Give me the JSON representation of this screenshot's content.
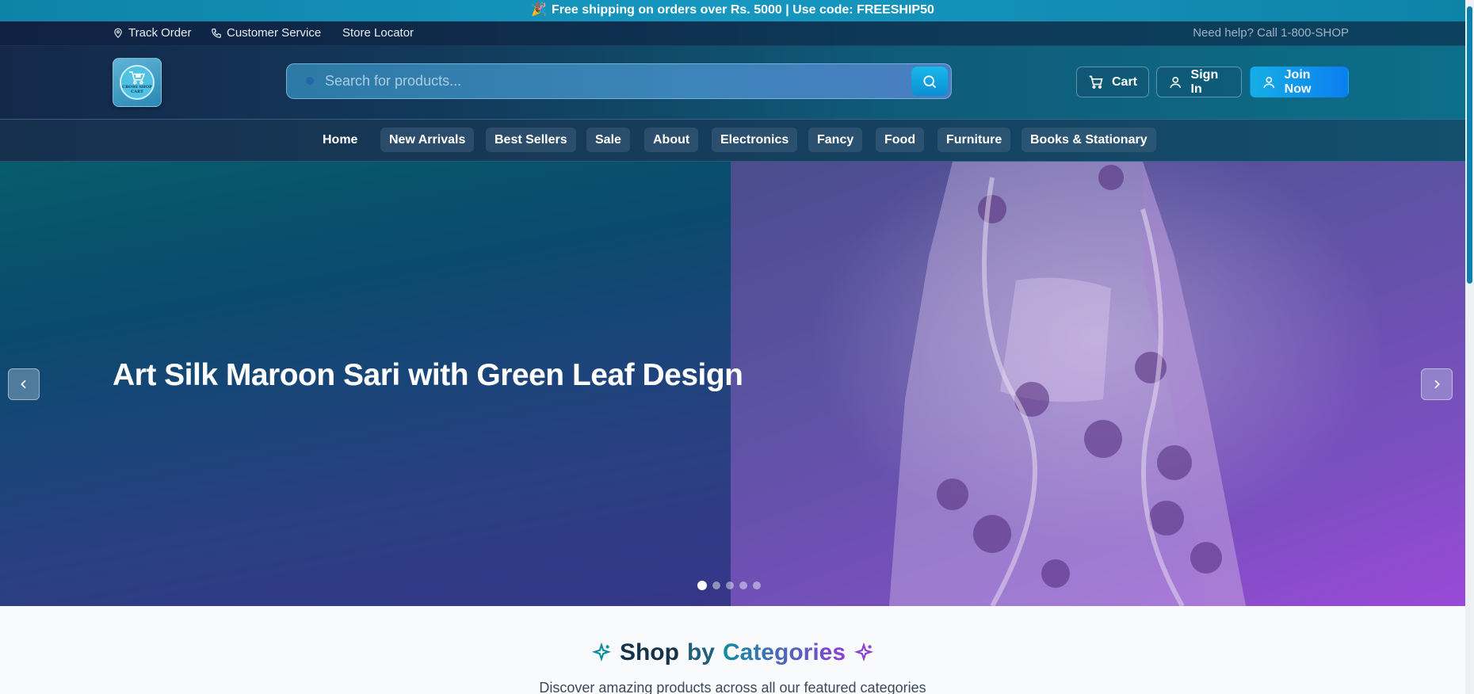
{
  "promo": {
    "emoji": "🎉",
    "text": "Free shipping on orders over Rs. 5000 | Use code: FREESHIP50"
  },
  "utility": {
    "track_order": "Track Order",
    "customer_service": "Customer Service",
    "store_locator": "Store Locator",
    "help": "Need help? Call 1-800-SHOP"
  },
  "logo": {
    "text_line1": "CROSS SHOP",
    "text_line2": "CART"
  },
  "search": {
    "placeholder": "Search for products..."
  },
  "header_buttons": {
    "cart": "Cart",
    "sign_in": "Sign In",
    "join": "Join Now"
  },
  "nav": {
    "items": [
      "Home",
      "New Arrivals",
      "Best Sellers",
      "Sale",
      "About",
      "Electronics",
      "Fancy",
      "Food",
      "Furniture",
      "Books & Stationary"
    ]
  },
  "hero": {
    "title": "Art Silk Maroon Sari with Green Leaf Design",
    "slide_count": 5,
    "active_slide": 1
  },
  "categories": {
    "title_part1": "Shop",
    "title_part2": "by",
    "title_part3": "Categories",
    "subtitle": "Discover amazing products across all our featured categories"
  },
  "colors": {
    "accent": "#0a8fd4",
    "join_button": "#0a7ff0",
    "promo_bg": "#1697c0",
    "hero_purple": "#9a49d8"
  }
}
